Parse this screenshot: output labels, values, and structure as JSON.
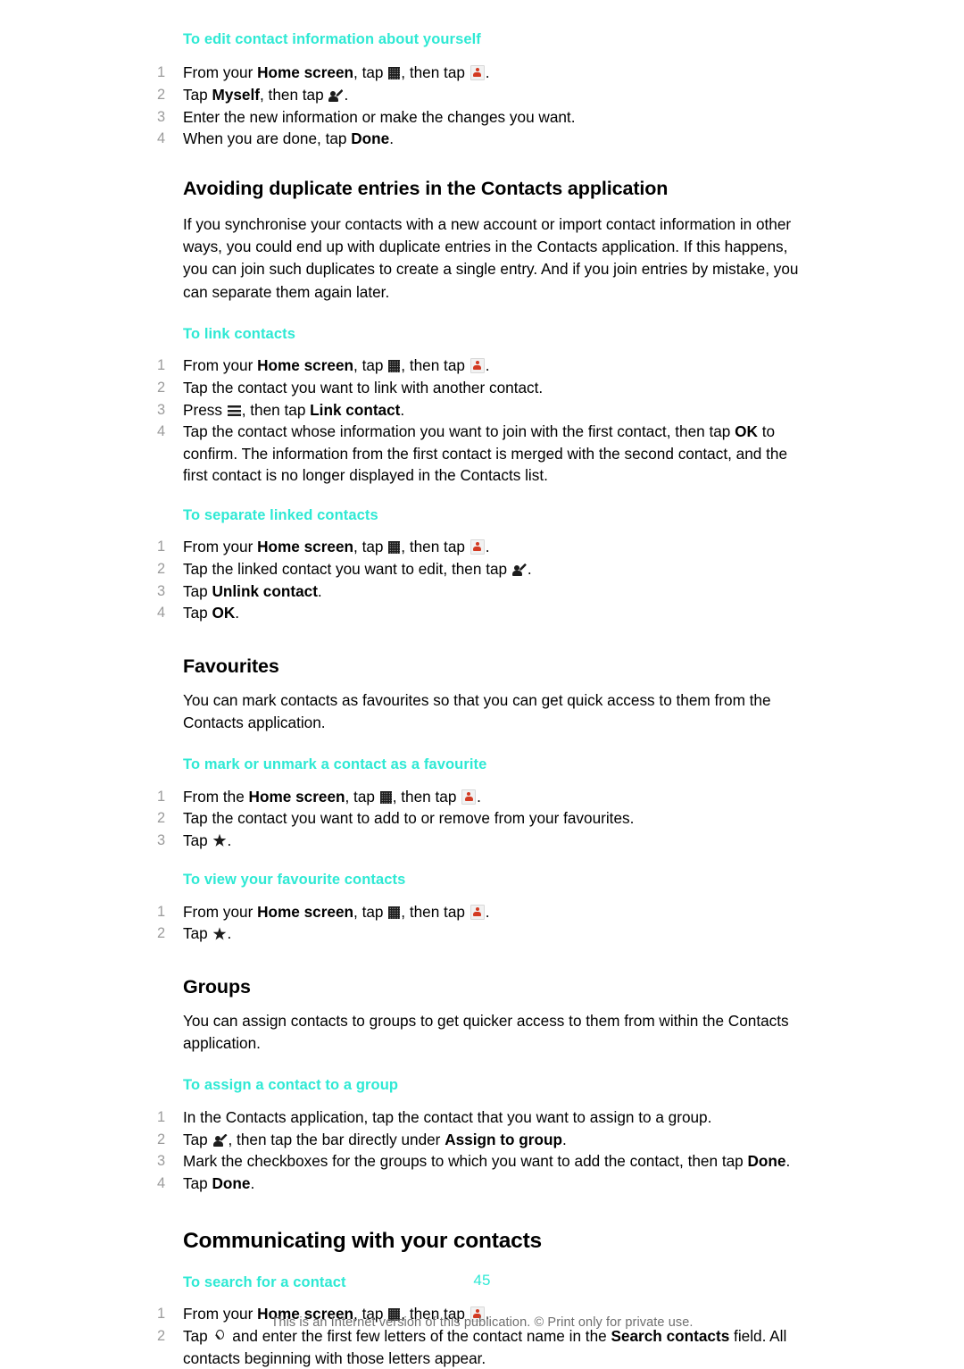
{
  "document": {
    "page_number": "45",
    "footer_note": "This is an Internet version of this publication. © Print only for private use."
  },
  "icons": {
    "app_drawer": "grid-icon",
    "contacts_app": "contacts-app-icon",
    "edit_contact": "edit-contact-icon",
    "menu_key": "menu-icon",
    "star": "star-icon",
    "search": "search-icon"
  },
  "colors": {
    "heading_accent": "#2ee9d4",
    "body_text": "#000000",
    "step_number": "#9b9b9b",
    "footer_text": "#6e6e6e",
    "contacts_icon_red": "#d33a22"
  },
  "sections": {
    "edit_self": {
      "title": "To edit contact information about yourself",
      "steps": {
        "s1_a": "From your ",
        "s1_b": "Home screen",
        "s1_c": ", tap ",
        "s1_d": ", then tap ",
        "s1_e": ".",
        "s2_a": "Tap ",
        "s2_b": "Myself",
        "s2_c": ", then tap ",
        "s2_d": ".",
        "s3": "Enter the new information or make the changes you want.",
        "s4_a": "When you are done, tap ",
        "s4_b": "Done",
        "s4_c": "."
      }
    },
    "avoiding_duplicates": {
      "title": "Avoiding duplicate entries in the Contacts application",
      "body": "If you synchronise your contacts with a new account or import contact information in other ways, you could end up with duplicate entries in the Contacts application. If this happens, you can join such duplicates to create a single entry. And if you join entries by mistake, you can separate them again later."
    },
    "link_contacts": {
      "title": "To link contacts",
      "steps": {
        "s1_a": "From your ",
        "s1_b": "Home screen",
        "s1_c": ", tap ",
        "s1_d": ", then tap ",
        "s1_e": ".",
        "s2": "Tap the contact you want to link with another contact.",
        "s3_a": "Press ",
        "s3_b": ", then tap ",
        "s3_c": "Link contact",
        "s3_d": ".",
        "s4_a": "Tap the contact whose information you want to join with the first contact, then tap ",
        "s4_b": "OK",
        "s4_c": " to confirm. The information from the first contact is merged with the second contact, and the first contact is no longer displayed in the Contacts list."
      }
    },
    "separate_linked": {
      "title": "To separate linked contacts",
      "steps": {
        "s1_a": "From your ",
        "s1_b": "Home screen",
        "s1_c": ", tap ",
        "s1_d": ", then tap ",
        "s1_e": ".",
        "s2_a": "Tap the linked contact you want to edit, then tap ",
        "s2_b": ".",
        "s3_a": "Tap ",
        "s3_b": "Unlink contact",
        "s3_c": ".",
        "s4_a": "Tap ",
        "s4_b": "OK",
        "s4_c": "."
      }
    },
    "favourites": {
      "title": "Favourites",
      "body": "You can mark contacts as favourites so that you can get quick access to them from the Contacts application.",
      "mark_task": {
        "title": "To mark or unmark a contact as a favourite",
        "steps": {
          "s1_a": "From the ",
          "s1_b": "Home screen",
          "s1_c": ", tap ",
          "s1_d": ", then tap ",
          "s1_e": ".",
          "s2": "Tap the contact you want to add to or remove from your favourites.",
          "s3_a": "Tap ",
          "s3_b": "."
        }
      },
      "view_task": {
        "title": "To view your favourite contacts",
        "steps": {
          "s1_a": "From your ",
          "s1_b": "Home screen",
          "s1_c": ", tap ",
          "s1_d": ", then tap ",
          "s1_e": ".",
          "s2_a": "Tap ",
          "s2_b": "."
        }
      }
    },
    "groups": {
      "title": "Groups",
      "body": "You can assign contacts to groups to get quicker access to them from within the Contacts application.",
      "assign_task": {
        "title": "To assign a contact to a group",
        "steps": {
          "s1": "In the Contacts application, tap the contact that you want to assign to a group.",
          "s2_a": "Tap ",
          "s2_b": ", then tap the bar directly under ",
          "s2_c": "Assign to group",
          "s2_d": ".",
          "s3_a": "Mark the checkboxes for the groups to which you want to add the contact, then tap ",
          "s3_b": "Done",
          "s3_c": ".",
          "s4_a": "Tap ",
          "s4_b": "Done",
          "s4_c": "."
        }
      }
    },
    "communicating": {
      "title": "Communicating with your contacts",
      "search_task": {
        "title": "To search for a contact",
        "steps": {
          "s1_a": "From your ",
          "s1_b": "Home screen",
          "s1_c": ", tap ",
          "s1_d": ", then tap ",
          "s1_e": ".",
          "s2_a": "Tap ",
          "s2_b": " and enter the first few letters of the contact name in the ",
          "s2_c": "Search contacts",
          "s2_d": " field. All contacts beginning with those letters appear."
        }
      }
    }
  }
}
